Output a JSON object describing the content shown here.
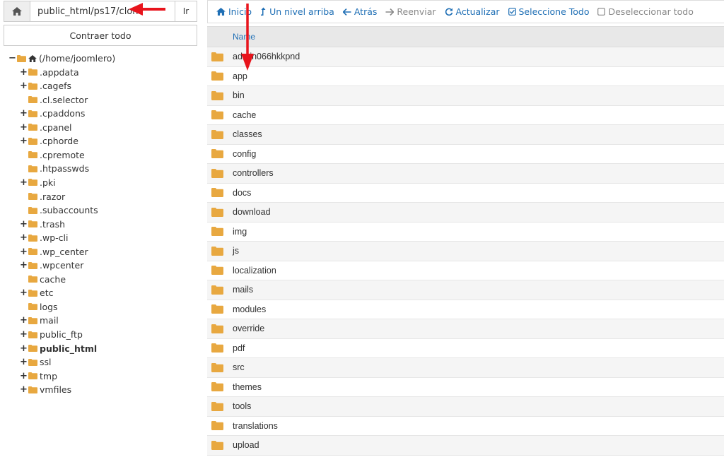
{
  "path_bar": {
    "value": "public_html/ps17/clon",
    "go_label": "Ir"
  },
  "collapse_label": "Contraer todo",
  "tree": {
    "root": "(/home/joomlero)",
    "items": [
      {
        "label": ".appdata",
        "expandable": true
      },
      {
        "label": ".cagefs",
        "expandable": true
      },
      {
        "label": ".cl.selector",
        "expandable": false
      },
      {
        "label": ".cpaddons",
        "expandable": true
      },
      {
        "label": ".cpanel",
        "expandable": true
      },
      {
        "label": ".cphorde",
        "expandable": true
      },
      {
        "label": ".cpremote",
        "expandable": false
      },
      {
        "label": ".htpasswds",
        "expandable": false
      },
      {
        "label": ".pki",
        "expandable": true
      },
      {
        "label": ".razor",
        "expandable": false
      },
      {
        "label": ".subaccounts",
        "expandable": false
      },
      {
        "label": ".trash",
        "expandable": true
      },
      {
        "label": ".wp-cli",
        "expandable": true
      },
      {
        "label": ".wp_center",
        "expandable": true
      },
      {
        "label": ".wpcenter",
        "expandable": true
      },
      {
        "label": "cache",
        "expandable": false
      },
      {
        "label": "etc",
        "expandable": true
      },
      {
        "label": "logs",
        "expandable": false
      },
      {
        "label": "mail",
        "expandable": true
      },
      {
        "label": "public_ftp",
        "expandable": true
      },
      {
        "label": "public_html",
        "expandable": true,
        "bold": true
      },
      {
        "label": "ssl",
        "expandable": true
      },
      {
        "label": "tmp",
        "expandable": true
      },
      {
        "label": "vmfiles",
        "expandable": true
      }
    ]
  },
  "toolbar": {
    "inicio": "Inicio",
    "up_level": "Un nivel arriba",
    "back": "Atrás",
    "forward": "Reenviar",
    "refresh": "Actualizar",
    "select_all": "Seleccione Todo",
    "deselect_all": "Deseleccionar todo"
  },
  "table": {
    "header_name": "Name",
    "rows": [
      "admin066hkkpnd",
      "app",
      "bin",
      "cache",
      "classes",
      "config",
      "controllers",
      "docs",
      "download",
      "img",
      "js",
      "localization",
      "mails",
      "modules",
      "override",
      "pdf",
      "src",
      "themes",
      "tools",
      "translations",
      "upload"
    ]
  },
  "colors": {
    "folder": "#e8a840",
    "link": "#1f6fb5",
    "annotation_arrow": "#e8141c"
  },
  "icons": {
    "home": "home-icon",
    "folder": "folder-icon",
    "up": "level-up-icon",
    "back": "arrow-left-icon",
    "forward": "arrow-right-icon",
    "refresh": "refresh-icon",
    "check": "check-square-icon",
    "box": "square-icon"
  }
}
